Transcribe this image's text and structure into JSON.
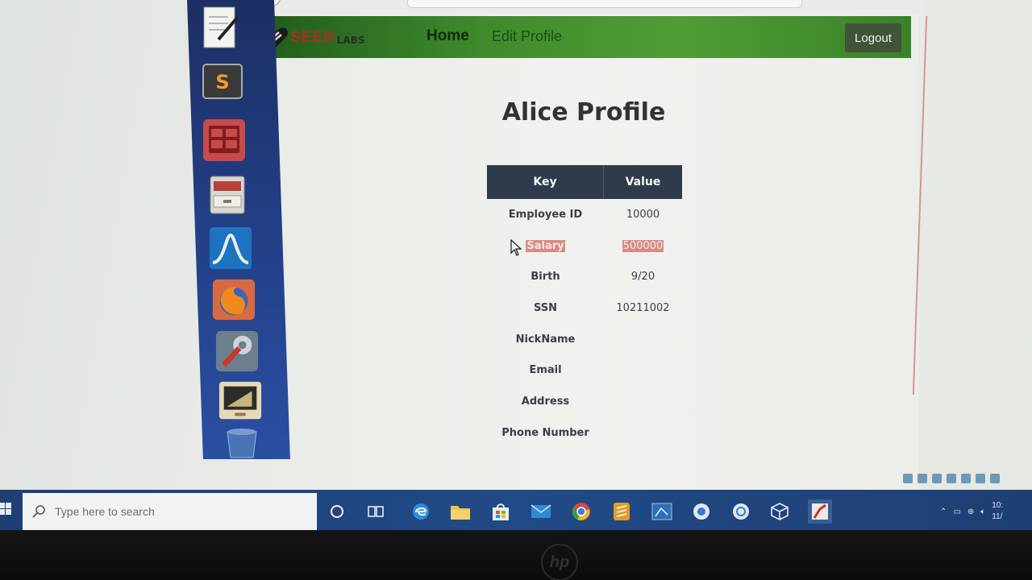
{
  "navbar": {
    "logo_text": "SEED",
    "logo_sub": "LABS",
    "home_label": "Home",
    "edit_profile_label": "Edit Profile",
    "logout_label": "Logout"
  },
  "page": {
    "title": "Alice Profile"
  },
  "profile_table": {
    "headers": [
      "Key",
      "Value"
    ],
    "rows": [
      {
        "key": "Employee ID",
        "value": "10000"
      },
      {
        "key": "Salary",
        "value": "500000"
      },
      {
        "key": "Birth",
        "value": "9/20"
      },
      {
        "key": "SSN",
        "value": "10211002"
      },
      {
        "key": "NickName",
        "value": ""
      },
      {
        "key": "Email",
        "value": ""
      },
      {
        "key": "Address",
        "value": ""
      },
      {
        "key": "Phone Number",
        "value": ""
      }
    ]
  },
  "dock": {
    "items": [
      "text-editor-icon",
      "sublime-text-icon",
      "terminal-icon",
      "file-manager-icon",
      "wireshark-icon",
      "firefox-icon",
      "settings-icon",
      "presentation-icon",
      "trash-icon"
    ]
  },
  "taskbar": {
    "search_placeholder": "Type here to search",
    "icons": [
      "cortana-icon",
      "task-view-icon",
      "edge-icon",
      "file-explorer-icon",
      "store-icon",
      "mail-icon",
      "chrome-icon",
      "sublime-icon",
      "network-icon",
      "app-icon",
      "sync-icon",
      "virtualbox-icon",
      "vm-app-icon"
    ]
  },
  "tray": {
    "time": "10:",
    "date": "11/"
  },
  "bezel": {
    "brand": "hp"
  },
  "colors": {
    "navbar_green": "#3e8a2c",
    "table_header": "#2f3a4a",
    "highlight": "#d98a84",
    "dock_blue": "#23418a",
    "taskbar_blue": "#214a86"
  }
}
